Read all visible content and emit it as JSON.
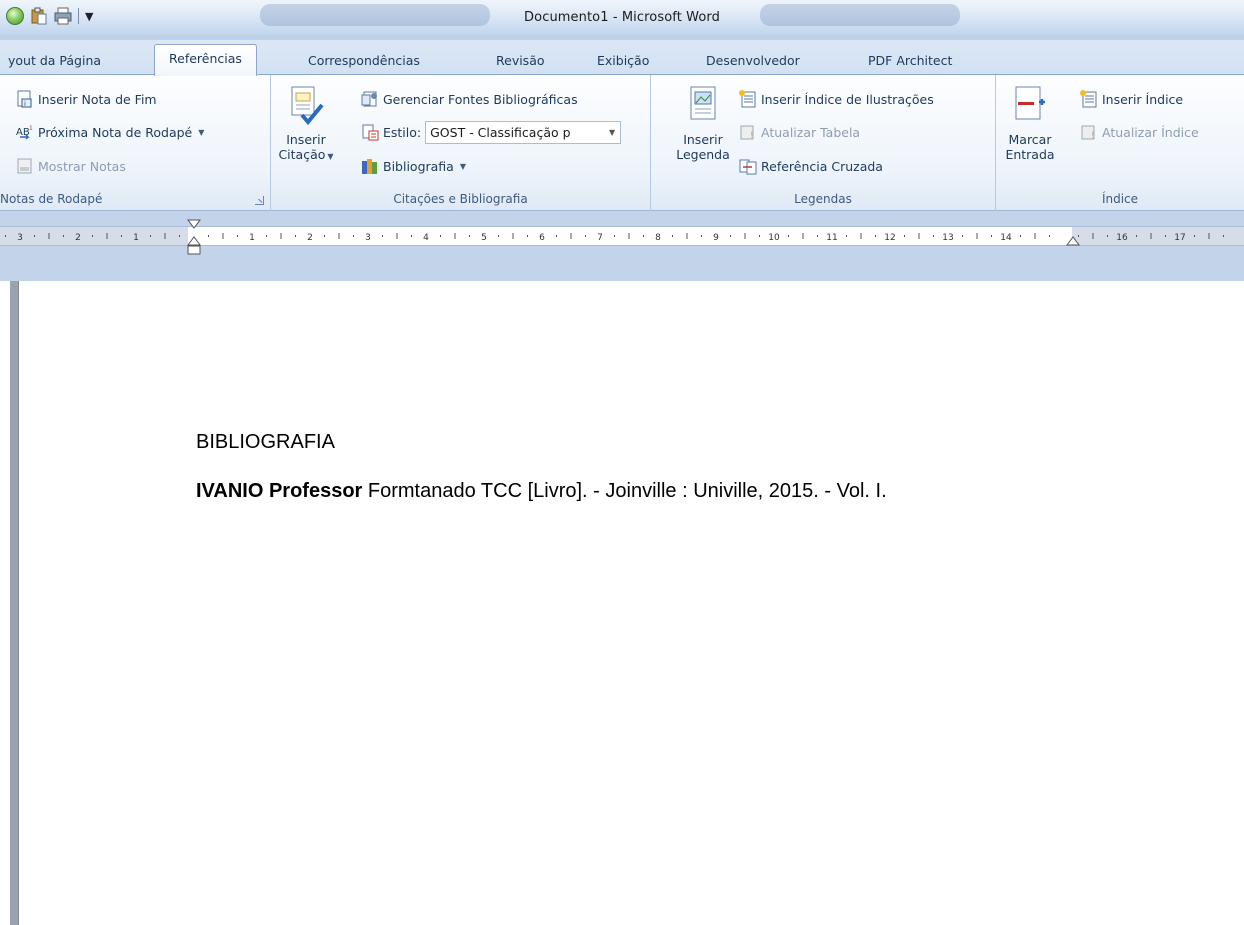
{
  "window": {
    "title": "Documento1  -  Microsoft Word"
  },
  "quick_access": {
    "icons": [
      "office-orb-icon",
      "paste-icon",
      "print-icon",
      "customize-dropdown-icon"
    ]
  },
  "tabs": [
    {
      "label": "yout da Página",
      "active": false
    },
    {
      "label": "Referências",
      "active": true
    },
    {
      "label": "Correspondências",
      "active": false
    },
    {
      "label": "Revisão",
      "active": false
    },
    {
      "label": "Exibição",
      "active": false
    },
    {
      "label": "Desenvolvedor",
      "active": false
    },
    {
      "label": "PDF Architect",
      "active": false
    }
  ],
  "ribbon": {
    "footnotes": {
      "label": "Notas de Rodapé",
      "insert_endnote": "Inserir Nota de Fim",
      "next_footnote": "Próxima Nota de Rodapé",
      "show_notes": "Mostrar Notas"
    },
    "citations": {
      "label": "Citações e Bibliografia",
      "insert_citation_line1": "Inserir",
      "insert_citation_line2": "Citação",
      "manage_sources": "Gerenciar Fontes Bibliográficas",
      "style_label": "Estilo:",
      "style_value": "GOST - Classificação p",
      "bibliography": "Bibliografia"
    },
    "captions": {
      "label": "Legendas",
      "insert_caption_line1": "Inserir",
      "insert_caption_line2": "Legenda",
      "insert_table_of_figures": "Inserir Índice de Ilustrações",
      "update_table": "Atualizar Tabela",
      "cross_reference": "Referência Cruzada"
    },
    "index": {
      "label": "Índice",
      "mark_entry_line1": "Marcar",
      "mark_entry_line2": "Entrada",
      "insert_index": "Inserir Índice",
      "update_index": "Atualizar Índice"
    }
  },
  "ruler": {
    "left_labels": [
      "3",
      "2",
      "1"
    ],
    "right_labels": [
      "1",
      "2",
      "3",
      "4",
      "5",
      "6",
      "7",
      "8",
      "9",
      "10",
      "11",
      "12",
      "13",
      "14",
      "16",
      "17"
    ]
  },
  "document": {
    "heading": "BIBLIOGRAFIA",
    "entry_author": "IVANIO Professor",
    "entry_rest": " Formtanado TCC [Livro]. - Joinville : Univille, 2015. - Vol. I."
  }
}
